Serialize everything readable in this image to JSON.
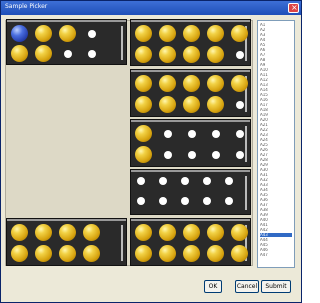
{
  "window": {
    "title": "Sample Picker"
  },
  "buttons": {
    "ok": "OK",
    "cancel": "Cancel",
    "submit": "Submit"
  },
  "list": {
    "items": [
      "A1",
      "A2",
      "A3",
      "A4",
      "A5",
      "A6",
      "A7",
      "A8",
      "A9",
      "A10",
      "A11",
      "A12",
      "A13",
      "A14",
      "A15",
      "A16",
      "A17",
      "A18",
      "A19",
      "A20",
      "A21",
      "A22",
      "A23",
      "A24",
      "A25",
      "A26",
      "A27",
      "A28",
      "A29",
      "A30",
      "A31",
      "A32",
      "A33",
      "A34",
      "A35",
      "A36",
      "A37",
      "A38",
      "A39",
      "A40",
      "A41",
      "A42",
      "A43",
      "A44",
      "A45",
      "A46",
      "A47"
    ],
    "selected_index": 42
  },
  "trays": [
    {
      "id": "tray-1",
      "rows": [
        [
          "blue",
          "gold",
          "gold",
          "white"
        ],
        [
          "gold",
          "gold",
          "white",
          "white"
        ]
      ]
    },
    {
      "id": "tray-2",
      "rows": [
        [
          "gold",
          "gold",
          "gold",
          "gold",
          "gold"
        ],
        [
          "gold",
          "gold",
          "gold",
          "gold",
          "white"
        ]
      ]
    },
    {
      "id": "tray-3",
      "rows": [
        [
          "gold",
          "gold",
          "gold",
          "gold",
          "gold"
        ],
        [
          "gold",
          "gold",
          "gold",
          "gold",
          "white"
        ]
      ]
    },
    {
      "id": "tray-4",
      "rows": [
        [
          "gold",
          "white",
          "white",
          "white",
          "white"
        ],
        [
          "gold",
          "white",
          "white",
          "white",
          "white"
        ]
      ]
    },
    {
      "id": "tray-5",
      "rows": [
        [
          "white",
          "white",
          "white",
          "white",
          "white"
        ],
        [
          "white",
          "white",
          "white",
          "white",
          "white"
        ]
      ]
    },
    {
      "id": "tray-6",
      "rows": [
        [
          "gold",
          "gold",
          "gold",
          "gold"
        ],
        [
          "gold",
          "gold",
          "gold",
          "gold"
        ]
      ]
    },
    {
      "id": "tray-7",
      "rows": [
        [
          "gold",
          "gold",
          "gold",
          "gold",
          "gold"
        ],
        [
          "gold",
          "gold",
          "gold",
          "gold",
          "gold"
        ]
      ]
    }
  ]
}
